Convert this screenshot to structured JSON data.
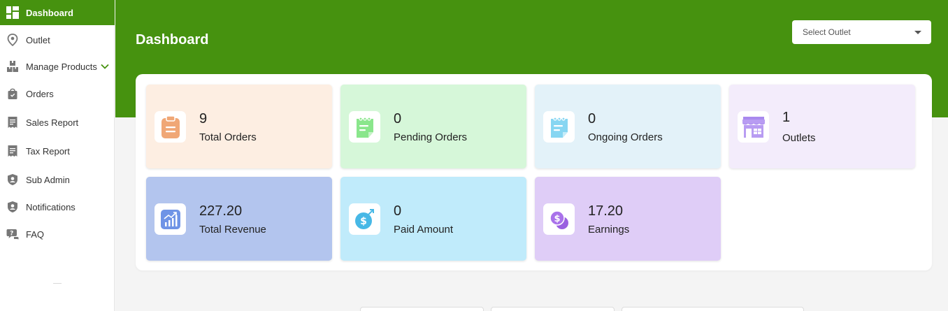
{
  "sidebar": {
    "items": [
      {
        "label": "Dashboard",
        "icon": "dashboard-icon"
      },
      {
        "label": "Outlet",
        "icon": "location-pin-icon"
      },
      {
        "label": "Manage Products",
        "icon": "boxes-icon"
      },
      {
        "label": "Orders",
        "icon": "shopping-bag-icon"
      },
      {
        "label": "Sales Report",
        "icon": "receipt-icon"
      },
      {
        "label": "Tax Report",
        "icon": "receipt-icon"
      },
      {
        "label": "Sub Admin",
        "icon": "user-shield-icon"
      },
      {
        "label": "Notifications",
        "icon": "user-shield-icon"
      },
      {
        "label": "FAQ",
        "icon": "faq-icon"
      }
    ]
  },
  "header": {
    "title": "Dashboard",
    "select_outlet_placeholder": "Select Outlet"
  },
  "stats": {
    "total_orders": {
      "value": "9",
      "label": "Total Orders"
    },
    "pending_orders": {
      "value": "0",
      "label": "Pending Orders"
    },
    "ongoing_orders": {
      "value": "0",
      "label": "Ongoing Orders"
    },
    "outlets": {
      "value": "1",
      "label": "Outlets"
    },
    "total_revenue": {
      "value": "227.20",
      "label": "Total Revenue"
    },
    "paid_amount": {
      "value": "0",
      "label": "Paid Amount"
    },
    "earnings": {
      "value": "17.20",
      "label": "Earnings"
    }
  },
  "colors": {
    "brand_green": "#46920f",
    "card_total_orders": "#fdeee2",
    "card_pending_orders": "#d6f7d9",
    "card_ongoing_orders": "#e3f2f9",
    "card_outlets": "#f3ecfb",
    "card_total_revenue": "#b3c5ee",
    "card_paid_amount": "#c0ebfb",
    "card_earnings": "#dfcdf7"
  }
}
